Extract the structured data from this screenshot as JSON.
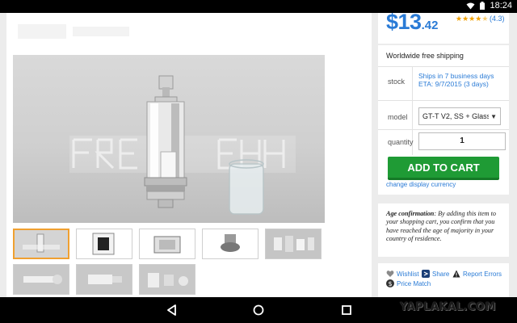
{
  "status_bar": {
    "time": "18:24"
  },
  "product": {
    "price_main": "$13",
    "price_cents": ".42",
    "rating_stars": 4.5,
    "rating_count": "(4.3)",
    "shipping": "Worldwide free shipping",
    "stock_label": "stock",
    "stock_line1": "Ships in 7 business days",
    "stock_line2": "ETA: 9/7/2015 (3 days)",
    "model_label": "model",
    "model_value": "GT-T V2, SS + Glass",
    "quantity_label": "quantity",
    "quantity_value": "1",
    "add_to_cart": "ADD TO CART",
    "change_currency": "change display currency"
  },
  "age_notice": {
    "title": "Age confirmation",
    "text": ": By adding this item to your shopping cart, you confirm that you have reached the age of majority in your country of residence."
  },
  "actions": {
    "wishlist": "Wishlist",
    "share": "Share",
    "report": "Report Errors",
    "price_match": "Price Match"
  },
  "watermark": "YAPLAKAL.COM",
  "colors": {
    "accent": "#2a7bd6",
    "cart_green": "#1f9b35",
    "star": "#f2a100"
  }
}
